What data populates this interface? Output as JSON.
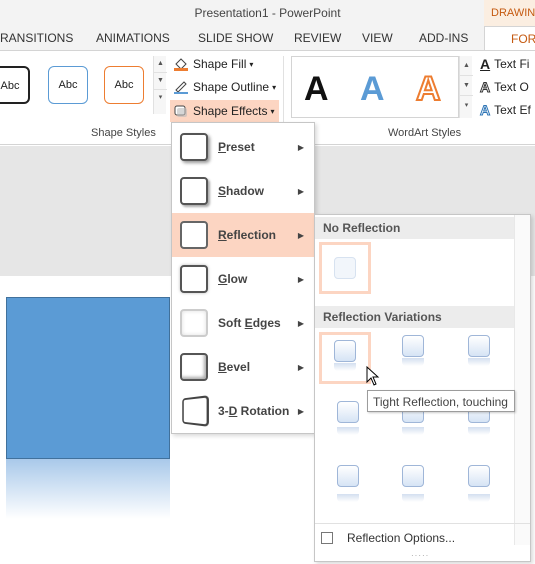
{
  "window": {
    "title": "Presentation1 - PowerPoint"
  },
  "context_tab": {
    "label": "DRAWIN"
  },
  "tabs": [
    "RANSITIONS",
    "ANIMATIONS",
    "SLIDE SHOW",
    "REVIEW",
    "VIEW",
    "ADD-INS",
    "FORM"
  ],
  "ribbon": {
    "shape_style_samples": [
      "Abc",
      "Abc",
      "Abc"
    ],
    "shape_fill": "Shape Fill",
    "shape_outline": "Shape Outline",
    "shape_effects": "Shape Effects",
    "group_shape_styles": "Shape Styles",
    "wordart_samples": [
      "A",
      "A",
      "A"
    ],
    "text_fill": "Text Fi",
    "text_outline": "Text O",
    "text_effects": "Text Ef",
    "group_wordart_styles": "WordArt Styles"
  },
  "effects_menu": {
    "items": [
      {
        "label": "Preset",
        "key": "P"
      },
      {
        "label": "Shadow",
        "key": "S"
      },
      {
        "label": "Reflection",
        "key": "R"
      },
      {
        "label": "Glow",
        "key": "G"
      },
      {
        "label": "Soft Edges",
        "key": "E"
      },
      {
        "label": "Bevel",
        "key": "B"
      },
      {
        "label": "3-D Rotation",
        "key": "D"
      }
    ],
    "active": "Reflection"
  },
  "reflection_submenu": {
    "no_reflection_header": "No Reflection",
    "variations_header": "Reflection Variations",
    "options_label": "Reflection Options...",
    "tooltip": "Tight Reflection, touching"
  },
  "colors": {
    "accent": "#c55a11",
    "highlight": "#fcd5c2",
    "shape": "#5b9bd5"
  }
}
